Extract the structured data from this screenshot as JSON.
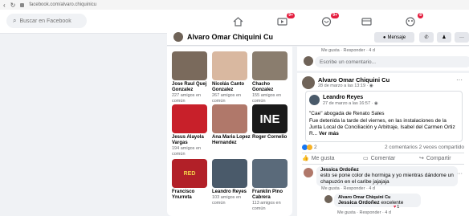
{
  "browser": {
    "url": "facebook.com/alvaro.chiquinicu"
  },
  "header": {
    "search_placeholder": "Buscar en Facebook",
    "badges": {
      "watch": "9+",
      "marketplace": "9+",
      "groups": "8"
    }
  },
  "profile": {
    "name": "Alvaro Omar Chiquini Cu",
    "message_label": "Mensaje"
  },
  "friends": [
    {
      "name": "Jose Raul Quej Gonzalez",
      "mutual": "227 amigos en común",
      "color": "#7a6a5c"
    },
    {
      "name": "Nicolás Canto Gonzalez",
      "mutual": "267 amigos en común",
      "color": "#d9b8a0"
    },
    {
      "name": "Chacho Gonzalez",
      "mutual": "155 amigos en común",
      "color": "#8a7d6e"
    },
    {
      "name": "Jesus Alayola Vargas",
      "mutual": "194 amigos en común",
      "color": "#c8202a"
    },
    {
      "name": "Ana Maria Lopez Hernandez",
      "mutual": "",
      "color": "#b0786a"
    },
    {
      "name": "Roger Cornelio",
      "mutual": "",
      "color": "#1a1a1a"
    },
    {
      "name": "Francisco Ynurreta",
      "mutual": "",
      "color": "#b22028"
    },
    {
      "name": "Leandro Reyes",
      "mutual": "103 amigos en común",
      "color": "#4a5a6a"
    },
    {
      "name": "Franklin Pino Cabrera",
      "mutual": "113 amigos en común",
      "color": "#5a6a7a"
    }
  ],
  "friend_badges": {
    "ine": "INE",
    "flag": "RED"
  },
  "top_comment": {
    "meta": "Me gusta · Responder · 4 d",
    "placeholder": "Escribe un comentario..."
  },
  "post": {
    "author": "Alvaro Omar Chiquini Cu",
    "date": "28 de marzo a las 13:19 · ",
    "shared_author": "Leandro Reyes",
    "shared_date": "27 de marzo a las 16:57 · ",
    "quote": "\"Cae\" abogada de Renato Sales",
    "body": "Fue detenida la tarde del viernes, en las instalaciones de la Junta Local de Conciliación y Arbitraje, Isabel del Carmen Ortiz R...",
    "see_more": "Ver más",
    "reactions_count": "2",
    "stats": "2 comentarios  2 veces compartido",
    "like_label": "Me gusta",
    "comment_label": "Comentar",
    "share_label": "Compartir"
  },
  "comments": [
    {
      "author": "Jessica Ordoñez",
      "text": "esto se pone color de hormiga y yo mientras dándome un chapuzón en el caribe jajajaja",
      "meta": "Me gusta · Responder · 4 d"
    }
  ],
  "reply": {
    "author": "Alvaro Omar Chiquini Cu",
    "mention": "Jessica Ordoñez",
    "text": " excelente",
    "meta": "Me gusta · Responder · 4 d",
    "likes": "1"
  }
}
